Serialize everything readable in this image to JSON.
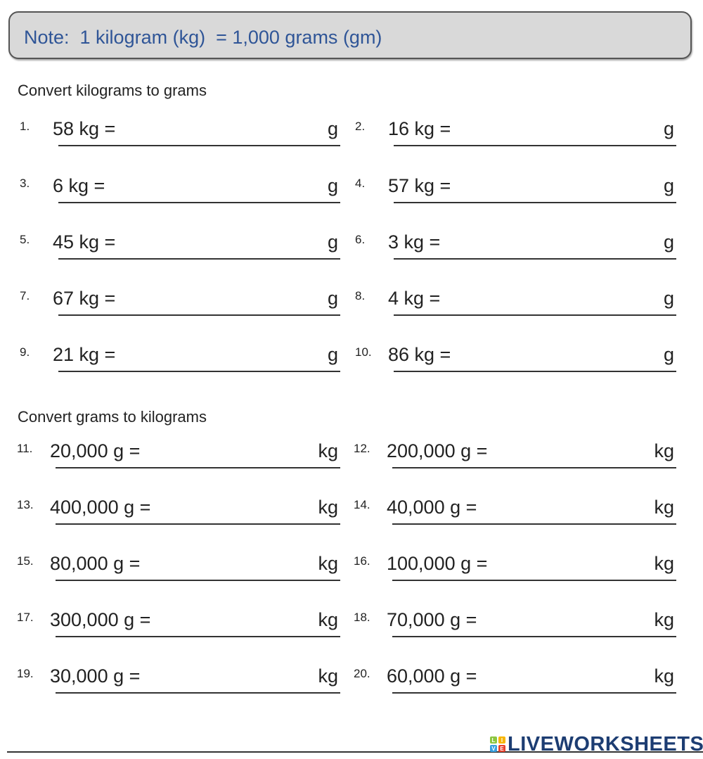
{
  "note": {
    "text": "Note:  1 kilogram (kg)  = 1,000 grams (gm)",
    "text_color": "#2f5597"
  },
  "sections": [
    {
      "title": "Convert kilograms to grams",
      "unit": "g",
      "problems": [
        {
          "num": "1.",
          "expr": "58 kg =",
          "answer": ""
        },
        {
          "num": "2.",
          "expr": "16 kg =",
          "answer": ""
        },
        {
          "num": "3.",
          "expr": "6 kg =",
          "answer": ""
        },
        {
          "num": "4.",
          "expr": "57 kg =",
          "answer": ""
        },
        {
          "num": "5.",
          "expr": "45 kg =",
          "answer": ""
        },
        {
          "num": "6.",
          "expr": "3 kg =",
          "answer": ""
        },
        {
          "num": "7.",
          "expr": "67 kg =",
          "answer": ""
        },
        {
          "num": "8.",
          "expr": "4 kg =",
          "answer": ""
        },
        {
          "num": "9.",
          "expr": "21 kg =",
          "answer": ""
        },
        {
          "num": "10.",
          "expr": "86 kg =",
          "answer": ""
        }
      ]
    },
    {
      "title": "Convert grams to kilograms",
      "unit": "kg",
      "problems": [
        {
          "num": "11.",
          "expr": "20,000 g =",
          "answer": ""
        },
        {
          "num": "12.",
          "expr": "200,000 g =",
          "answer": ""
        },
        {
          "num": "13.",
          "expr": "400,000 g =",
          "answer": ""
        },
        {
          "num": "14.",
          "expr": "40,000 g =",
          "answer": ""
        },
        {
          "num": "15.",
          "expr": "80,000 g =",
          "answer": ""
        },
        {
          "num": "16.",
          "expr": "100,000 g =",
          "answer": ""
        },
        {
          "num": "17.",
          "expr": "300,000 g =",
          "answer": ""
        },
        {
          "num": "18.",
          "expr": "70,000 g =",
          "answer": ""
        },
        {
          "num": "19.",
          "expr": "30,000 g =",
          "answer": ""
        },
        {
          "num": "20.",
          "expr": "60,000 g =",
          "answer": ""
        }
      ]
    }
  ],
  "branding": {
    "logo_letters": [
      "L",
      "I",
      "V",
      "E"
    ],
    "logo_letter_colors": [
      "#8cc63f",
      "#f7b500",
      "#3aa0e0",
      "#e8412c"
    ],
    "logo_text": "LIVEWORKSHEETS",
    "logo_color": "#1d3d72"
  }
}
